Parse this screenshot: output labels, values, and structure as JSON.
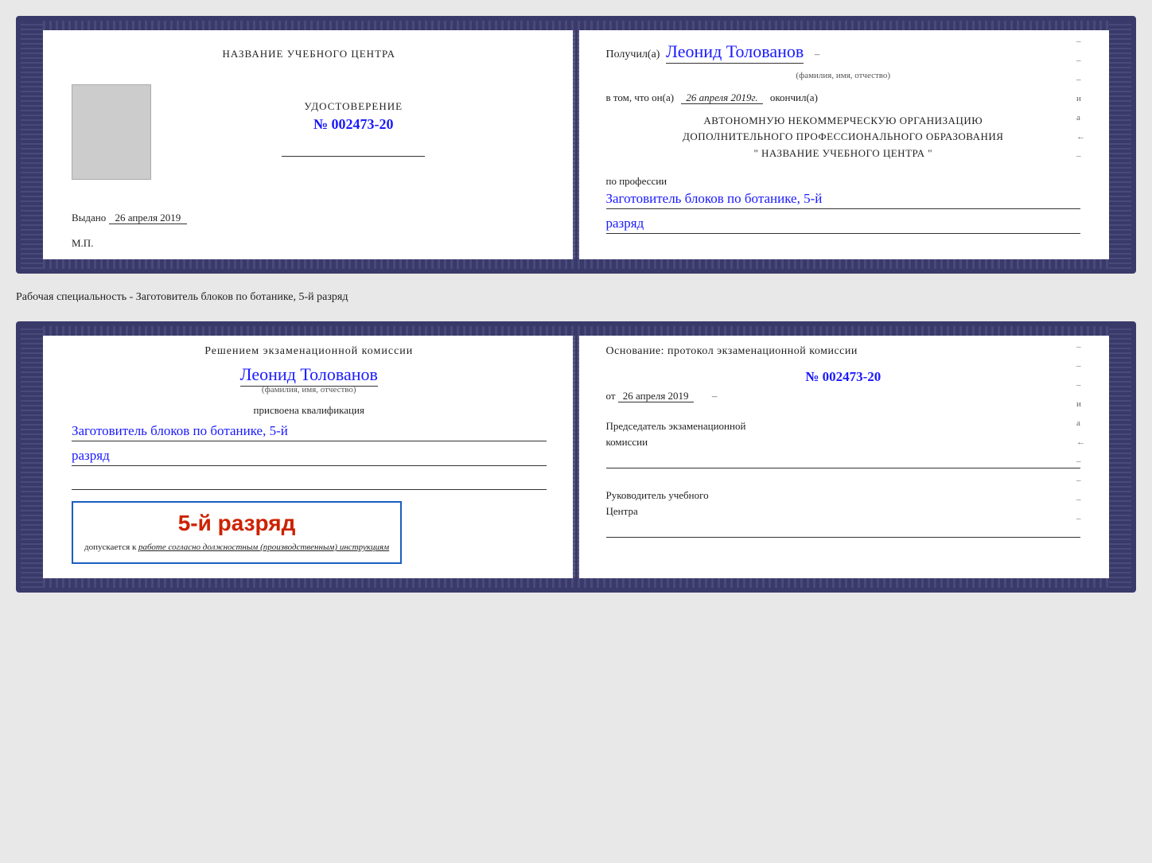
{
  "card1": {
    "left": {
      "title": "НАЗВАНИЕ УЧЕБНОГО ЦЕНТРА",
      "cert_label": "УДОСТОВЕРЕНИЕ",
      "cert_number": "№ 002473-20",
      "issued_label": "Выдано",
      "issued_date": "26 апреля 2019",
      "mp_label": "М.П."
    },
    "right": {
      "received_prefix": "Получил(а)",
      "recipient_name": "Леонид Толованов",
      "name_sublabel": "(фамилия, имя, отчество)",
      "in_that_prefix": "в том, что он(а)",
      "date_value": "26 апреля 2019г.",
      "finished_suffix": "окончил(а)",
      "institution_line1": "АВТОНОМНУЮ НЕКОММЕРЧЕСКУЮ ОРГАНИЗАЦИЮ",
      "institution_line2": "ДОПОЛНИТЕЛЬНОГО ПРОФЕССИОНАЛЬНОГО ОБРАЗОВАНИЯ",
      "institution_line3": "\"   НАЗВАНИЕ УЧЕБНОГО ЦЕНТРА   \"",
      "profession_prefix": "по профессии",
      "profession_value": "Заготовитель блоков по ботанике, 5-й",
      "rank_value": "разряд"
    }
  },
  "between_text": "Рабочая специальность - Заготовитель блоков по ботанике, 5-й разряд",
  "card2": {
    "left": {
      "decision_text": "Решением экзаменационной комиссии",
      "name_value": "Леонид Толованов",
      "name_sublabel": "(фамилия, имя, отчество)",
      "awarded_text": "присвоена квалификация",
      "qualification_line1": "Заготовитель блоков по ботанике, 5-й",
      "rank_value": "разряд",
      "stamp_grade": "5-й разряд",
      "stamp_prefix": "допускается к",
      "stamp_italic": "работе согласно должностным (производственным) инструкциям"
    },
    "right": {
      "basis_text": "Основание: протокол экзаменационной комиссии",
      "protocol_number": "№  002473-20",
      "date_prefix": "от",
      "date_value": "26 апреля 2019",
      "chair_line1": "Председатель экзаменационной",
      "chair_line2": "комиссии",
      "head_line1": "Руководитель учебного",
      "head_line2": "Центра",
      "right_margin": [
        "–",
        "–",
        "–",
        "и",
        "а",
        "←"
      ]
    }
  }
}
